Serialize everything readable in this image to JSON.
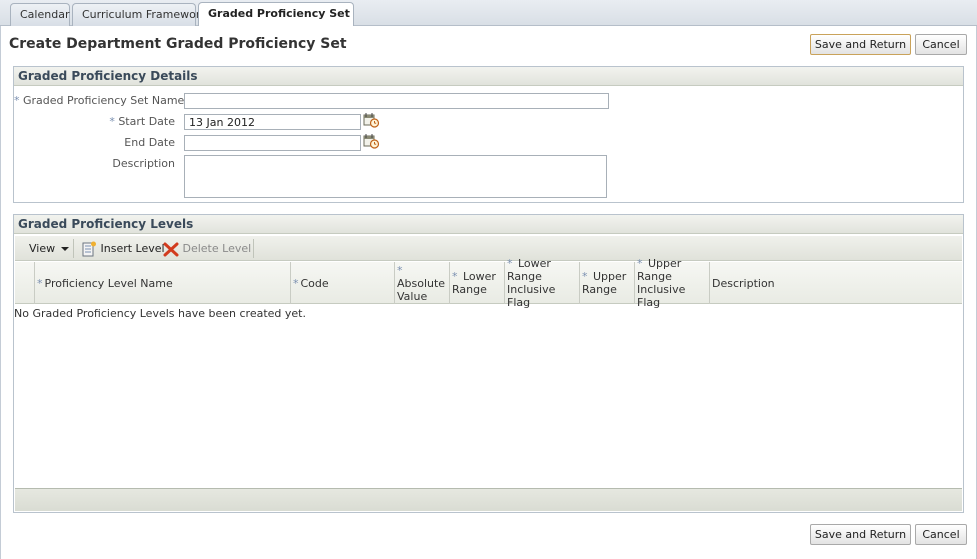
{
  "tabs": [
    {
      "label": "Calendar"
    },
    {
      "label": "Curriculum Framework"
    },
    {
      "label": "Graded Proficiency Set"
    }
  ],
  "page": {
    "title": "Create Department Graded Proficiency Set",
    "save_return_label": "Save and Return",
    "cancel_label": "Cancel"
  },
  "details": {
    "header": "Graded Proficiency Details",
    "required_mark": "*",
    "fields": {
      "set_name": {
        "label": "Graded Proficiency Set Name",
        "value": ""
      },
      "start_date": {
        "label": "Start Date",
        "value": "13 Jan 2012"
      },
      "end_date": {
        "label": "End Date",
        "value": ""
      },
      "description": {
        "label": "Description",
        "value": ""
      }
    }
  },
  "levels": {
    "header": "Graded Proficiency Levels",
    "toolbar": {
      "view_label": "View",
      "insert_label": "Insert Level",
      "delete_label": "Delete Level"
    },
    "columns": [
      {
        "required": true,
        "label": "Proficiency Level Name"
      },
      {
        "required": true,
        "label": "Code"
      },
      {
        "required": true,
        "label": "Absolute Value"
      },
      {
        "required": true,
        "label": "Lower Range"
      },
      {
        "required": true,
        "label": "Lower Range Inclusive Flag"
      },
      {
        "required": true,
        "label": "Upper Range"
      },
      {
        "required": true,
        "label": "Upper Range Inclusive Flag"
      },
      {
        "required": false,
        "label": "Description"
      }
    ],
    "empty_message": "No Graded Proficiency Levels have been created yet."
  },
  "icons": {
    "calendar": "calendar-icon",
    "insert": "insert-level-icon",
    "delete": "delete-x-icon",
    "view_dropdown": "chevron-down-icon"
  },
  "colors": {
    "accent_focus": "#c9a25a",
    "delete_red": "#d23b1e",
    "required_star": "#7a8fb0"
  }
}
